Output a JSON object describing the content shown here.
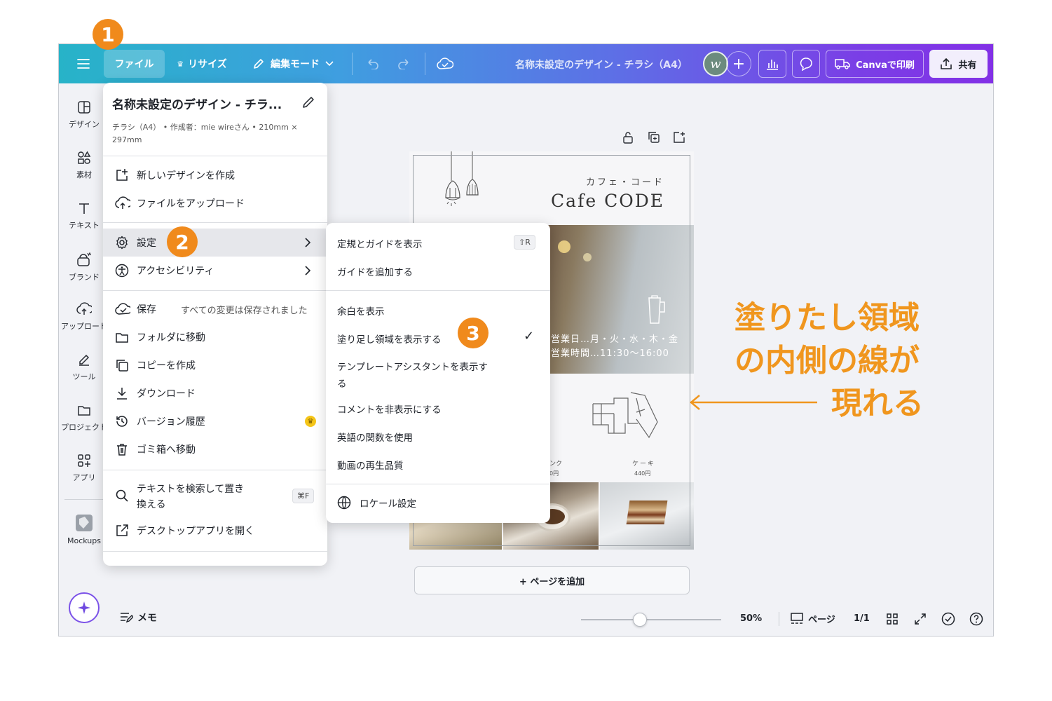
{
  "topbar": {
    "file_label": "ファイル",
    "resize_label": "リサイズ",
    "edit_mode_label": "編集モード",
    "doc_title": "名称未設定のデザイン - チラシ（A4）",
    "print_label": "Canvaで印刷",
    "share_label": "共有"
  },
  "sidebar": {
    "items": [
      {
        "label": "デザイン",
        "icon": "layout-icon"
      },
      {
        "label": "素材",
        "icon": "shapes-icon"
      },
      {
        "label": "テキスト",
        "icon": "text-icon"
      },
      {
        "label": "ブランド",
        "icon": "brand-icon"
      },
      {
        "label": "アップロード",
        "icon": "upload-icon"
      },
      {
        "label": "ツール",
        "icon": "tools-icon"
      },
      {
        "label": "プロジェクト",
        "icon": "folder-icon"
      },
      {
        "label": "アプリ",
        "icon": "apps-icon"
      },
      {
        "label": "Mockups",
        "icon": "mockups-icon"
      }
    ]
  },
  "file_menu": {
    "title": "名称未設定のデザイン - チラ...",
    "meta_line1": "チラシ（A4） • 作成者：mie wireさん • 210mm ×",
    "meta_line2": "297mm",
    "new_design": "新しいデザインを作成",
    "upload_file": "ファイルをアップロード",
    "settings": "設定",
    "accessibility": "アクセシビリティ",
    "save": "保存",
    "save_status": "すべての変更は保存されました",
    "move_folder": "フォルダに移動",
    "make_copy": "コピーを作成",
    "download": "ダウンロード",
    "version_history": "バージョン履歴",
    "trash": "ゴミ箱へ移動",
    "find_replace_1": "テキストを検索して置き",
    "find_replace_2": "換える",
    "find_shortcut": "⌘F",
    "desktop_app": "デスクトップアプリを開く"
  },
  "settings_submenu": {
    "show_rulers": "定規とガイドを表示",
    "show_rulers_shortcut": "⇧R",
    "add_guides": "ガイドを追加する",
    "show_margins": "余白を表示",
    "show_bleed": "塗り足し領域を表示する",
    "show_bleed_checked": "✓",
    "template_assistant_1": "テンプレートアシスタントを表示す",
    "template_assistant_2": "る",
    "hide_comments": "コメントを非表示にする",
    "english_functions": "英語の関数を使用",
    "video_quality": "動画の再生品質",
    "locale": "ロケール設定"
  },
  "canvas": {
    "cafe_kana": "カフェ・コード",
    "cafe_name": "Cafe CODE",
    "hours_days": "営業日…月・火・水・木・金",
    "hours_time": "営業時間…11:30～16:00",
    "drink_label": "ンク",
    "drink_price": "0円",
    "cake_label": "ケーキ",
    "cake_price": "440円",
    "add_page": "+ ページを追加"
  },
  "bottombar": {
    "memo": "メモ",
    "zoom_percent": "50%",
    "zoom_level": 0.5,
    "pages_label": "ページ",
    "page_count": "1/1"
  },
  "steps": {
    "one": "1",
    "two": "2",
    "three": "3"
  },
  "annotation": {
    "line1": "塗りたし領域",
    "line2": "の内側の線が",
    "line3": "現れる"
  },
  "colors": {
    "accent_orange": "#f08a1c",
    "topbar_start": "#27b3c8",
    "topbar_end": "#8230e6"
  }
}
